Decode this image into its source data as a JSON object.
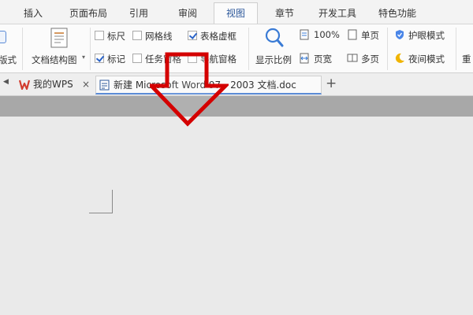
{
  "ribbon_tabs": [
    "插入",
    "页面布局",
    "引用",
    "审阅",
    "视图",
    "章节",
    "开发工具",
    "特色功能"
  ],
  "active_tab": "视图",
  "ribbon": {
    "left_cut_label": "版式",
    "doc_structure_label": "文档结构图",
    "ruler_label": "标尺",
    "gridlines_label": "网格线",
    "table_gridlines_label": "表格虚框",
    "marks_label": "标记",
    "task_pane_label": "任务窗格",
    "nav_pane_label": "导航窗格",
    "zoom_label": "显示比例",
    "zoom_100_label": "100%",
    "page_width_label": "页宽",
    "single_page_label": "单页",
    "multi_page_label": "多页",
    "eye_mode_label": "护眼模式",
    "night_mode_label": "夜间模式",
    "right_cut_label": "重"
  },
  "checkbox_states": {
    "ruler": false,
    "gridlines": false,
    "table_gridlines": true,
    "marks": true,
    "task_pane": false,
    "nav_pane": false
  },
  "doc_tabs": {
    "wps_home": "我的WPS",
    "document": "新建 Microsoft Word 97 - 2003 文档.doc",
    "close_glyph": "×",
    "add_glyph": "+"
  },
  "colors": {
    "accent_blue": "#2b579a",
    "wps_red": "#d23c2e",
    "annotation_red": "#d40000"
  }
}
